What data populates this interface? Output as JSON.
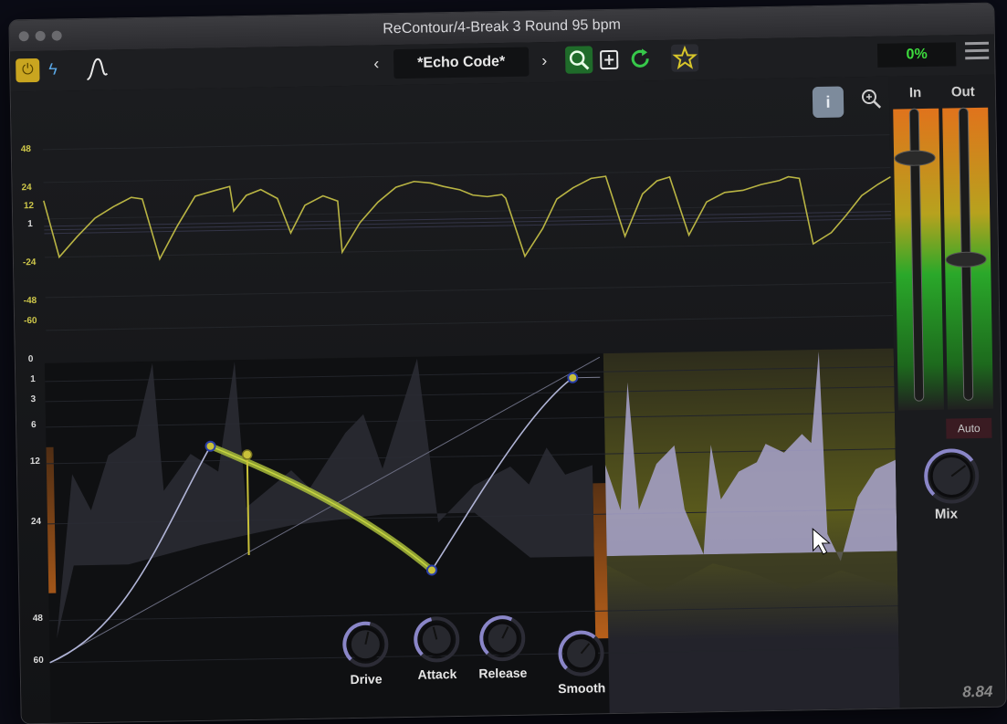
{
  "window": {
    "title": "ReContour/4-Break 3 Round 95 bpm"
  },
  "toolbar": {
    "prev_label": "‹",
    "next_label": "›",
    "preset_name": "*Echo Code*",
    "percent": "0%",
    "icons": [
      "power-icon",
      "bolt-icon",
      "curve-icon",
      "search-icon",
      "add-preset-icon",
      "refresh-icon",
      "star-icon",
      "menu-icon"
    ]
  },
  "graph": {
    "info_label": "i",
    "top_scale": [
      "48",
      "24",
      "12",
      "1",
      "-24",
      "-48",
      "-60"
    ],
    "bottom_scale": [
      "0",
      "1",
      "3",
      "6",
      "12",
      "24",
      "48",
      "60"
    ]
  },
  "knobs": [
    {
      "name": "Drive",
      "value": 0.55
    },
    {
      "name": "Attack",
      "value": 0.45
    },
    {
      "name": "Release",
      "value": 0.6
    },
    {
      "name": "Smooth",
      "value": 0.65
    }
  ],
  "meters": {
    "in_label": "In",
    "out_label": "Out",
    "auto_label": "Auto",
    "mix_label": "Mix",
    "mix_value": 0.7
  },
  "version": "8.84",
  "colors": {
    "accent_yellow": "#c9c13a",
    "curve": "#aeb3d8",
    "meter_green": "#2ec02e",
    "meter_orange": "#e07a1a",
    "pct_green": "#3ddc3d"
  }
}
